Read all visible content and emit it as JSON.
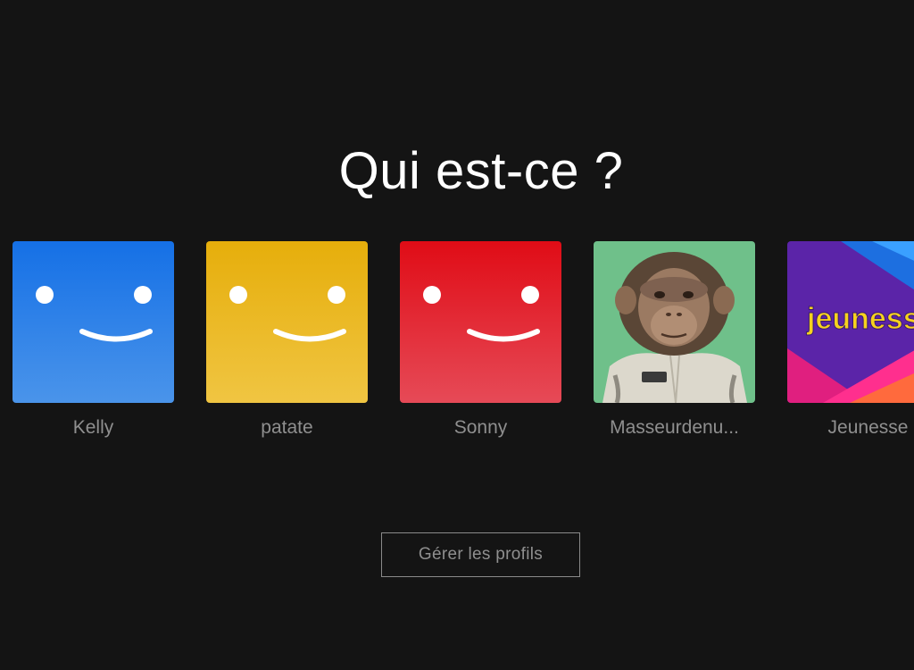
{
  "page": {
    "title": "Qui est-ce ?"
  },
  "profiles": [
    {
      "name": "Kelly",
      "avatar": "smiley-blue",
      "color_top": "#1570e6",
      "color_bottom": "#4a94ea"
    },
    {
      "name": "patate",
      "avatar": "smiley-yellow",
      "color_top": "#e6ae0b",
      "color_bottom": "#f0c542"
    },
    {
      "name": "Sonny",
      "avatar": "smiley-red",
      "color_top": "#e00c16",
      "color_bottom": "#e64a57"
    },
    {
      "name": "Masseurdenu...",
      "avatar": "chimpanzee-in-jumpsuit",
      "color_bg": "#6fc08a"
    },
    {
      "name": "Jeunesse",
      "avatar": "jeunesse-kids-logo",
      "logo_text": "jeunesse"
    }
  ],
  "actions": {
    "manage_label": "Gérer les profils"
  }
}
